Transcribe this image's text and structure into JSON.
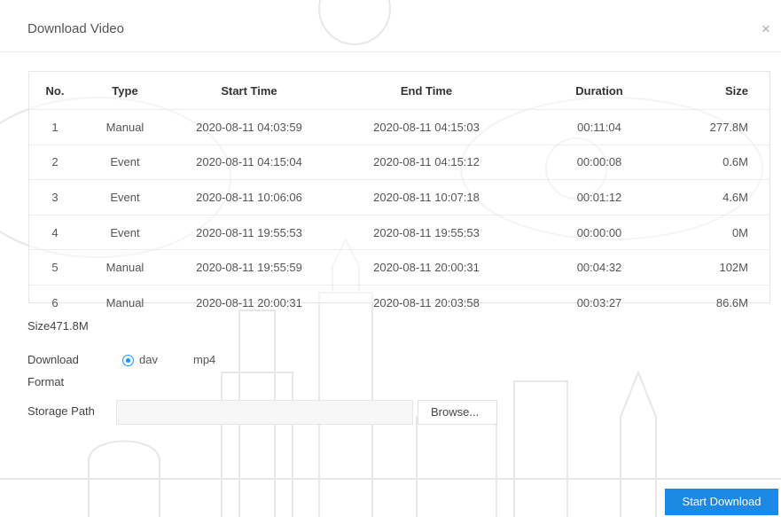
{
  "dialog": {
    "title": "Download Video",
    "close_glyph": "×"
  },
  "table": {
    "headers": [
      "No.",
      "Type",
      "Start Time",
      "End Time",
      "Duration",
      "Size"
    ],
    "rows": [
      {
        "no": "1",
        "type": "Manual",
        "start": "2020-08-11 04:03:59",
        "end": "2020-08-11 04:15:03",
        "duration": "00:11:04",
        "size": "277.8M"
      },
      {
        "no": "2",
        "type": "Event",
        "start": "2020-08-11 04:15:04",
        "end": "2020-08-11 04:15:12",
        "duration": "00:00:08",
        "size": "0.6M"
      },
      {
        "no": "3",
        "type": "Event",
        "start": "2020-08-11 10:06:06",
        "end": "2020-08-11 10:07:18",
        "duration": "00:01:12",
        "size": "4.6M"
      },
      {
        "no": "4",
        "type": "Event",
        "start": "2020-08-11 19:55:53",
        "end": "2020-08-11 19:55:53",
        "duration": "00:00:00",
        "size": "0M"
      },
      {
        "no": "5",
        "type": "Manual",
        "start": "2020-08-11 19:55:59",
        "end": "2020-08-11 20:00:31",
        "duration": "00:04:32",
        "size": "102M"
      },
      {
        "no": "6",
        "type": "Manual",
        "start": "2020-08-11 20:00:31",
        "end": "2020-08-11 20:03:58",
        "duration": "00:03:27",
        "size": "86.6M"
      }
    ]
  },
  "summary": {
    "size_total": "Size471.8M"
  },
  "format": {
    "label_line1": "Download",
    "label_line2": "Format",
    "options": [
      "dav",
      "mp4"
    ],
    "selected": "dav"
  },
  "storage": {
    "label": "Storage Path",
    "value": "",
    "browse_label": "Browse..."
  },
  "actions": {
    "start_label": "Start Download"
  },
  "colors": {
    "accent": "#1e88e5",
    "radio_selected": "#1e90ff"
  },
  "background": {
    "watermark": "faint city skyline and camera illustration"
  }
}
